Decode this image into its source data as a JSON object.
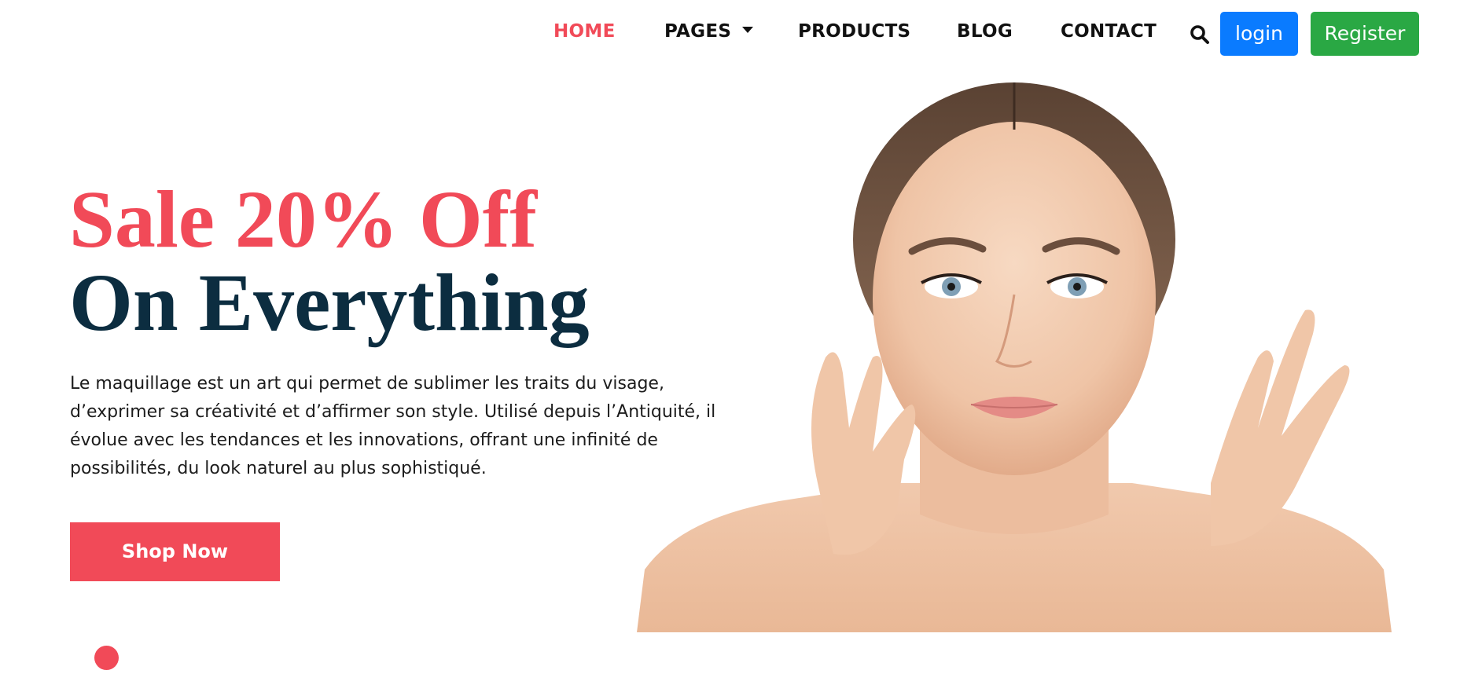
{
  "nav": {
    "home": "HOME",
    "pages": "PAGES",
    "products": "PRODUCTS",
    "blog": "BLOG",
    "contact": "CONTACT",
    "search_icon": "search-icon",
    "login": "login",
    "register": "Register"
  },
  "hero": {
    "title_line1": "Sale 20% Off",
    "title_line2": "On Everything",
    "description": "Le maquillage est un art qui permet de sublimer les traits du visage, d’exprimer sa créativité et d’affirmer son style. Utilisé depuis l’Antiquité, il évolue avec les tendances et les innovations, offrant une infinité de possibilités, du look naturel au plus sophistiqué.",
    "cta": "Shop Now"
  },
  "colors": {
    "accent": "#f14a58",
    "heading_dark": "#0c2d40",
    "login_bg": "#0a7bff",
    "register_bg": "#2aa844",
    "nav_text": "#111111"
  }
}
